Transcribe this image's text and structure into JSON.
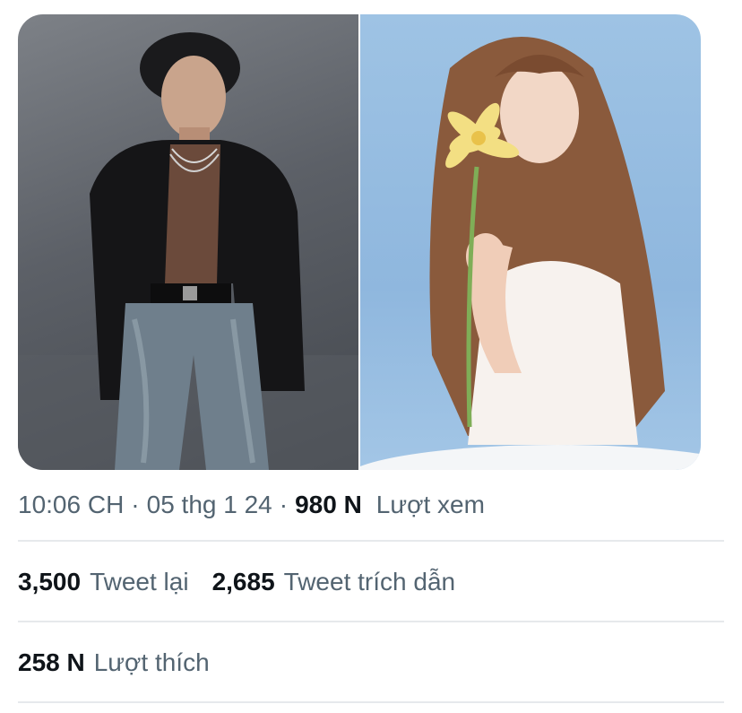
{
  "media": {
    "images": [
      {
        "description": "man-in-black-blazer"
      },
      {
        "description": "woman-with-yellow-flower"
      }
    ]
  },
  "tweet_meta": {
    "time": "10:06 CH",
    "separator": "·",
    "date": "05 thg 1 24",
    "views_count": "980 N",
    "views_label": "Lượt xem"
  },
  "stats": {
    "retweets_count": "3,500",
    "retweets_label": "Tweet lại",
    "quotes_count": "2,685",
    "quotes_label": "Tweet trích dẫn"
  },
  "likes": {
    "count": "258 N",
    "label": "Lượt thích"
  },
  "colors": {
    "text_primary": "#0f1419",
    "text_secondary": "#536471",
    "divider": "#e6e9ec"
  }
}
